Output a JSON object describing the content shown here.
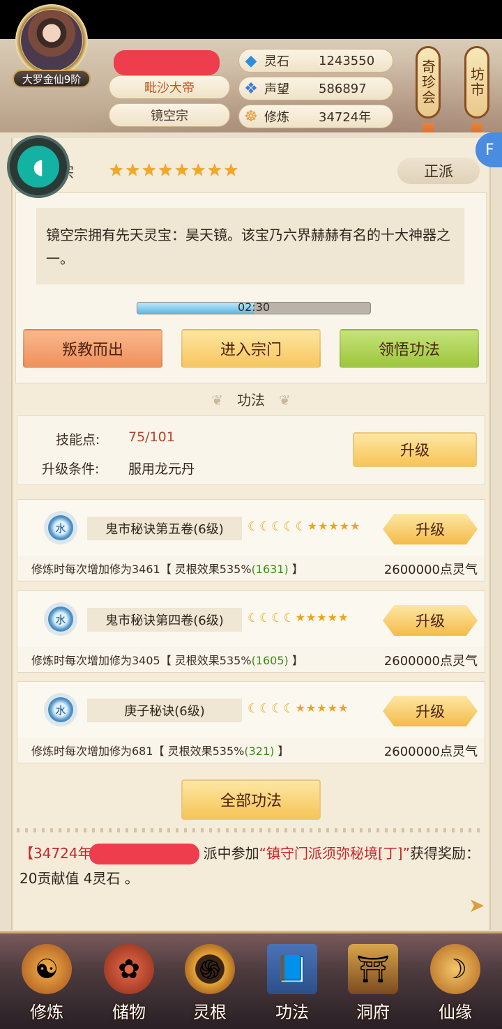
{
  "header": {
    "rank_badge": "大罗金仙9阶",
    "player_title": "毗沙大帝",
    "player_sect": "镜空宗",
    "stats": [
      {
        "icon": "spirit-stone-icon",
        "label": "灵石",
        "value": "1243550"
      },
      {
        "icon": "reputation-icon",
        "label": "声望",
        "value": "586897"
      },
      {
        "icon": "meditation-icon",
        "label": "修炼",
        "value": "34724年"
      }
    ],
    "side_signs": [
      "奇珍会",
      "坊市"
    ]
  },
  "sect": {
    "name_partial": "宗",
    "star_count": 8,
    "alignment": "正派",
    "description": "镜空宗拥有先天灵宝：昊天镜。该宝乃六界赫赫有名的十大神器之一。",
    "timer_text": "02:30",
    "timer_fill": 0.5,
    "actions": [
      "叛教而出",
      "进入宗门",
      "领悟功法"
    ]
  },
  "skills": {
    "section_title": "功法",
    "points_label": "技能点:",
    "points_value": "75/101",
    "condition_label": "升级条件:",
    "condition_value": "服用龙元丹",
    "upgrade_label": "升级"
  },
  "techniques": [
    {
      "element": "水",
      "name": "鬼市秘诀第五卷(6级)",
      "moons": 5,
      "stars": 5,
      "upgrade": "升级",
      "desc_prefix": "修炼时每次增加修为3461【 灵根效果535%",
      "desc_highlight": "(1631)",
      "desc_suffix": " 】",
      "cost": "2600000点灵气"
    },
    {
      "element": "水",
      "name": "鬼市秘诀第四卷(6级)",
      "moons": 4,
      "stars": 5,
      "upgrade": "升级",
      "desc_prefix": "修炼时每次增加修为3405【 灵根效果535%",
      "desc_highlight": "(1605)",
      "desc_suffix": " 】",
      "cost": "2600000点灵气"
    },
    {
      "element": "水",
      "name": "庚子秘诀(6级)",
      "moons": 4,
      "stars": 5,
      "upgrade": "升级",
      "desc_prefix": "修炼时每次增加修为681【 灵根效果535%",
      "desc_highlight": "(321)",
      "desc_suffix": " 】",
      "cost": "2600000点灵气"
    }
  ],
  "all_techniques_label": "全部功法",
  "log": {
    "year": "【34724年",
    "middle": "派中参加",
    "event": "“镇守门派须弥秘境[丁]”",
    "reward": "获得奖励：20贡献值 4灵石 。"
  },
  "nav": [
    {
      "label": "修炼",
      "icon": "monk-icon"
    },
    {
      "label": "储物",
      "icon": "bag-icon"
    },
    {
      "label": "灵根",
      "icon": "spirit-root-icon"
    },
    {
      "label": "功法",
      "icon": "book-icon"
    },
    {
      "label": "洞府",
      "icon": "pavilion-icon"
    },
    {
      "label": "仙缘",
      "icon": "gourd-icon"
    }
  ],
  "colors": {
    "accent": "#f7c458",
    "redacted": "#ee3d4c",
    "highlight_green": "#3d8a1c",
    "log_red": "#c8242a"
  }
}
